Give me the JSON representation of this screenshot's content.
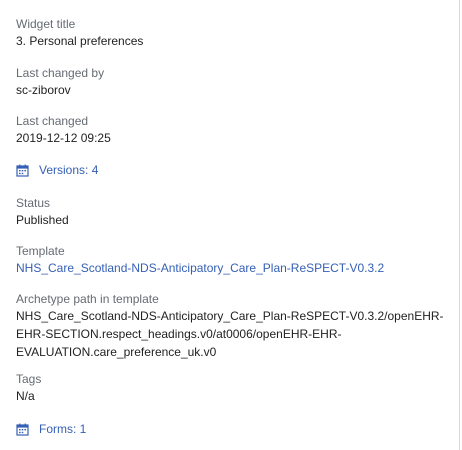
{
  "widget_title": {
    "label": "Widget title",
    "value": "3. Personal preferences"
  },
  "last_changed_by": {
    "label": "Last changed by",
    "value": "sc-ziborov"
  },
  "last_changed": {
    "label": "Last changed",
    "value": "2019-12-12 09:25"
  },
  "versions": {
    "label": "Versions: 4",
    "icon": "calendar-icon"
  },
  "status": {
    "label": "Status",
    "value": "Published"
  },
  "template": {
    "label": "Template",
    "value": "NHS_Care_Scotland-NDS-Anticipatory_Care_Plan-ReSPECT-V0.3.2"
  },
  "archetype_path": {
    "label": "Archetype path in template",
    "lines": [
      "NHS_Care_Scotland-NDS-Anticipatory_Care_Plan-ReSPECT-V0.3.2/openEHR-",
      "EHR-SECTION.respect_headings.v0/at0006/openEHR-EHR-",
      "EVALUATION.care_preference_uk.v0"
    ]
  },
  "tags": {
    "label": "Tags",
    "value": "N/a"
  },
  "forms": {
    "label": "Forms: 1",
    "icon": "calendar-icon"
  },
  "colors": {
    "link": "#3560b5",
    "label": "#666b72",
    "border": "#d6d9de"
  }
}
